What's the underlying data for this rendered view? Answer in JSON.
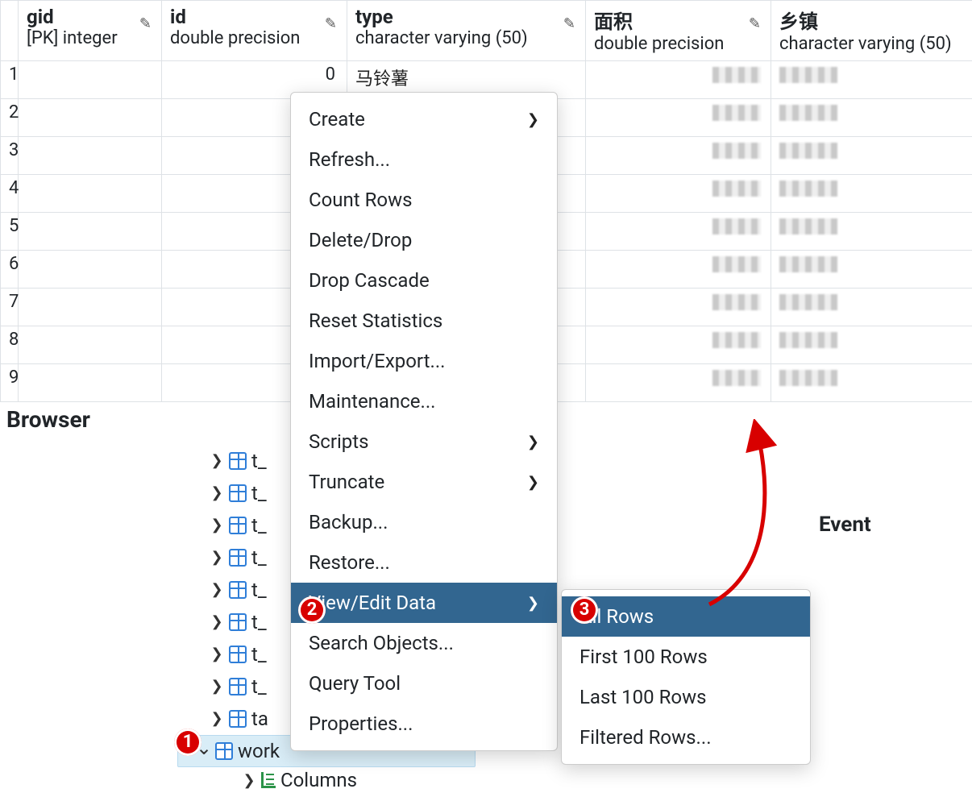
{
  "columns": {
    "gid": {
      "title": "gid",
      "subtitle": "[PK] integer"
    },
    "id": {
      "title": "id",
      "subtitle": "double precision"
    },
    "type": {
      "title": "type",
      "subtitle": "character varying (50)"
    },
    "area": {
      "title": "面积",
      "subtitle": "double precision"
    },
    "town": {
      "title": "乡镇",
      "subtitle": "character varying (50)"
    }
  },
  "rows": [
    {
      "n": "1",
      "id": "0",
      "type_peek": "马铃薯"
    },
    {
      "n": "2"
    },
    {
      "n": "3"
    },
    {
      "n": "4"
    },
    {
      "n": "5"
    },
    {
      "n": "6"
    },
    {
      "n": "7"
    },
    {
      "n": "8"
    },
    {
      "n": "9"
    }
  ],
  "browser_label": "Browser",
  "tree": {
    "items": [
      {
        "label": "t_"
      },
      {
        "label": "t_"
      },
      {
        "label": "t_"
      },
      {
        "label": "t_"
      },
      {
        "label": "t_"
      },
      {
        "label": "t_"
      },
      {
        "label": "t_"
      },
      {
        "label": "t_"
      },
      {
        "label": "ta"
      }
    ],
    "selected": {
      "label": "work"
    },
    "child": {
      "label": "Columns"
    }
  },
  "menu1": [
    {
      "label": "Create",
      "submenu": true
    },
    {
      "label": "Refresh..."
    },
    {
      "label": "Count Rows"
    },
    {
      "label": "Delete/Drop"
    },
    {
      "label": "Drop Cascade"
    },
    {
      "label": "Reset Statistics"
    },
    {
      "label": "Import/Export..."
    },
    {
      "label": "Maintenance..."
    },
    {
      "label": "Scripts",
      "submenu": true
    },
    {
      "label": "Truncate",
      "submenu": true
    },
    {
      "label": "Backup..."
    },
    {
      "label": "Restore..."
    },
    {
      "label": "View/Edit Data",
      "submenu": true,
      "hover": true
    },
    {
      "label": "Search Objects..."
    },
    {
      "label": "Query Tool"
    },
    {
      "label": "Properties..."
    }
  ],
  "menu2": [
    {
      "label": "All Rows",
      "hover": true
    },
    {
      "label": "First 100 Rows"
    },
    {
      "label": "Last 100 Rows"
    },
    {
      "label": "Filtered Rows..."
    }
  ],
  "event_label": "Event",
  "annotations": {
    "a1": "1",
    "a2": "2",
    "a3": "3"
  }
}
